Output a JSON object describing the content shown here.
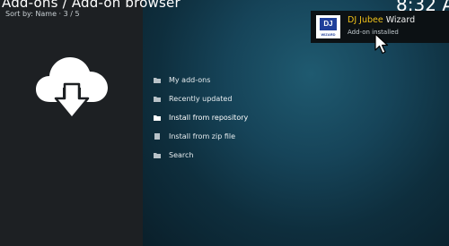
{
  "header": {
    "breadcrumb": "Add-ons / Add-on browser",
    "sort_info": "Sort by: Name  ·  3 / 5",
    "clock": "8:32 A"
  },
  "hero_icon": "cloud-download-icon",
  "menu": {
    "items": [
      {
        "label": "My add-ons",
        "icon": "folder-icon"
      },
      {
        "label": "Recently updated",
        "icon": "folder-icon"
      },
      {
        "label": "Install from repository",
        "icon": "folder-icon"
      },
      {
        "label": "Install from zip file",
        "icon": "file-icon"
      },
      {
        "label": "Search",
        "icon": "folder-icon"
      }
    ]
  },
  "notification": {
    "title_accent": "DJ Jubee",
    "title_rest": "Wizard",
    "subtitle": "Add-on installed",
    "thumb_text": "DJ",
    "thumb_subtext": "WIZARD"
  },
  "colors": {
    "accent": "#f0c21a",
    "left_panel": "#1d2023",
    "right_panel": "#164459"
  }
}
